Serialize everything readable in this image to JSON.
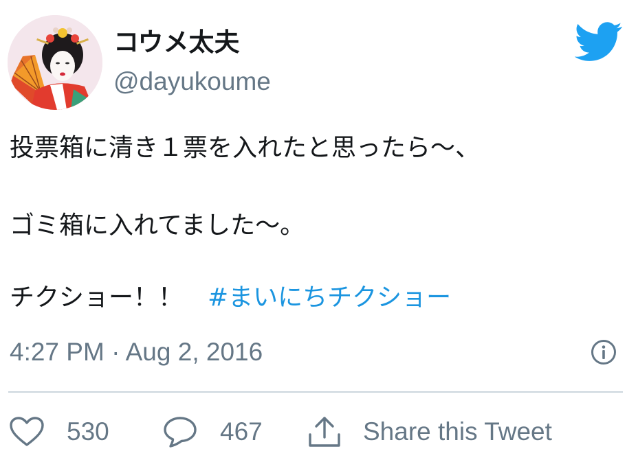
{
  "user": {
    "display_name": "コウメ太夫",
    "handle": "@dayukoume"
  },
  "tweet": {
    "lines": [
      "投票箱に清き１票を入れたと思ったら〜、",
      "ゴミ箱に入れてました〜。",
      "チクショー！！　"
    ],
    "hashtag": "#まいにちチクショー",
    "timestamp": "4:27 PM · Aug 2, 2016"
  },
  "actions": {
    "likes": "530",
    "replies": "467",
    "share_label": "Share this Tweet"
  },
  "colors": {
    "text": "#14171a",
    "secondary": "#657786",
    "accent": "#1b95e0",
    "bird": "#1da1f2",
    "divider": "#ccd6dd"
  },
  "icons": {
    "brand": "twitter-bird-icon",
    "info": "info-icon",
    "like": "heart-icon",
    "reply": "speech-bubble-icon",
    "share": "share-upload-icon"
  }
}
